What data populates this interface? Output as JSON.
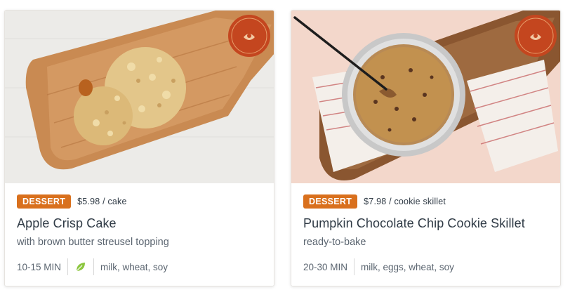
{
  "cards": [
    {
      "photo_icon": "apple-crisp-cake-photo",
      "seal": {
        "line1": "Thanksgiving",
        "line2": "Favorites"
      },
      "tag": "DESSERT",
      "price": "$5.98 / cake",
      "title": "Apple Crisp Cake",
      "subtitle": "with brown butter streusel topping",
      "time": "10-15 MIN",
      "diet_icon": "leaf-icon",
      "allergens": "milk, wheat, soy"
    },
    {
      "photo_icon": "pumpkin-cookie-skillet-photo",
      "seal": {
        "line1": "Thanksgiving",
        "line2": "Favorites"
      },
      "tag": "DESSERT",
      "price": "$7.98 / cookie skillet",
      "title": "Pumpkin Chocolate Chip Cookie Skillet",
      "subtitle": "ready-to-bake",
      "time": "20-30 MIN",
      "allergens": "milk, eggs, wheat, soy"
    }
  ],
  "colors": {
    "tag_bg": "#d9701d",
    "seal_bg": "#c4461f",
    "leaf": "#8cc63f"
  }
}
